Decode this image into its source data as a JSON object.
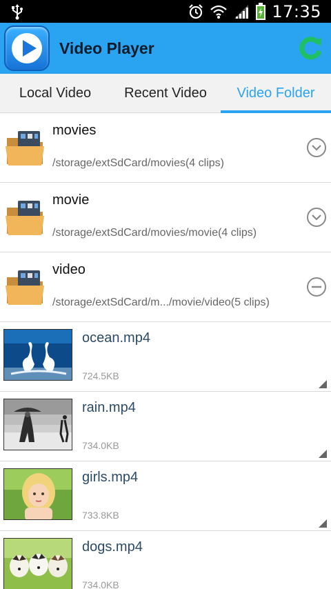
{
  "status_bar": {
    "time": "17:35",
    "icons": [
      "usb-icon",
      "alarm-icon",
      "wifi-icon",
      "signal-icon",
      "battery-charging-icon"
    ]
  },
  "app_bar": {
    "title": "Video Player",
    "logo": "play-icon",
    "action": "refresh-icon",
    "accent": "#2aa3f0"
  },
  "tabs": [
    {
      "label": "Local Video",
      "selected": false
    },
    {
      "label": "Recent Video",
      "selected": false
    },
    {
      "label": "Video Folder",
      "selected": true
    }
  ],
  "folders": [
    {
      "name": "movies",
      "path": "/storage/extSdCard/movies(4 clips)",
      "state": "collapsed"
    },
    {
      "name": "movie",
      "path": "/storage/extSdCard/movies/movie(4 clips)",
      "state": "collapsed"
    },
    {
      "name": "video",
      "path": "/storage/extSdCard/m.../movie/video(5 clips)",
      "state": "expanded"
    }
  ],
  "videos": [
    {
      "name": "ocean.mp4",
      "size": "724.5KB",
      "thumbnail": "swans"
    },
    {
      "name": "rain.mp4",
      "size": "734.0KB",
      "thumbnail": "rain"
    },
    {
      "name": "girls.mp4",
      "size": "733.8KB",
      "thumbnail": "girl"
    },
    {
      "name": "dogs.mp4",
      "size": "734.0KB",
      "thumbnail": "puppies"
    }
  ]
}
